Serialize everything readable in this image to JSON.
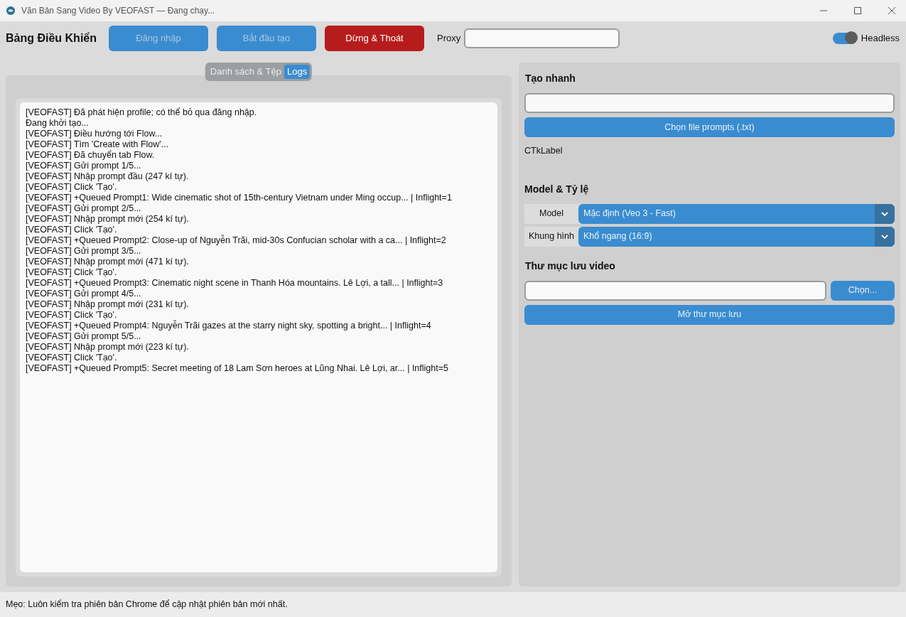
{
  "window": {
    "title": "Văn Bản Sang Video By VEOFAST — Đang chạy..."
  },
  "toolbar": {
    "title": "Bảng Điều Khiển",
    "buttons": [
      {
        "label": "Đăng nhập",
        "kind": "primary",
        "disabled": true
      },
      {
        "label": "Bắt đầu tạo",
        "kind": "primary",
        "disabled": true
      },
      {
        "label": "Dừng & Thoát",
        "kind": "danger",
        "disabled": false
      }
    ],
    "proxy": {
      "label": "Proxy"
    },
    "headless": {
      "label": "Headless",
      "on": true
    }
  },
  "tabs": [
    {
      "label": "Danh sách & Tệp",
      "selected": false
    },
    {
      "label": "Logs",
      "selected": true
    }
  ],
  "log_lines": [
    "[VEOFAST] Đã phát hiện profile; có thể bỏ qua đăng nhập.",
    "Đang khởi tạo...",
    "[VEOFAST] Điều hướng tới Flow...",
    "[VEOFAST] Tìm 'Create with Flow'...",
    "[VEOFAST] Đã chuyển tab Flow.",
    "[VEOFAST] Gửi prompt 1/5...",
    "[VEOFAST] Nhập prompt đầu (247 kí tự).",
    "[VEOFAST] Click 'Tạo'.",
    "[VEOFAST] +Queued Prompt1: Wide cinematic shot of 15th-century Vietnam under Ming occup... | Inflight=1",
    "[VEOFAST] Gửi prompt 2/5...",
    "[VEOFAST] Nhập prompt mới (254 kí tự).",
    "[VEOFAST] Click 'Tạo'.",
    "[VEOFAST] +Queued Prompt2: Close-up of Nguyễn Trãi, mid-30s Confucian scholar with a ca... | Inflight=2",
    "[VEOFAST] Gửi prompt 3/5...",
    "[VEOFAST] Nhập prompt mới (471 kí tự).",
    "[VEOFAST] Click 'Tạo'.",
    "[VEOFAST] +Queued Prompt3: Cinematic night scene in Thanh Hóa mountains. Lê Lợi, a tall... | Inflight=3",
    "[VEOFAST] Gửi prompt 4/5...",
    "[VEOFAST] Nhập prompt mới (231 kí tự).",
    "[VEOFAST] Click 'Tạo'.",
    "[VEOFAST] +Queued Prompt4: Nguyễn Trãi gazes at the starry night sky, spotting a bright... | Inflight=4",
    "[VEOFAST] Gửi prompt 5/5...",
    "[VEOFAST] Nhập prompt mới (223 kí tự).",
    "[VEOFAST] Click 'Tạo'.",
    "[VEOFAST] +Queued Prompt5: Secret meeting of 18 Lam Sơn heroes at Lũng Nhai. Lê Lợi, ar... | Inflight=5"
  ],
  "quick_create": {
    "title": "Tạo nhanh",
    "file_button": "Chọn file prompts (.txt)",
    "status_label": "CTkLabel"
  },
  "model_ratio": {
    "title": "Model & Tỷ lệ",
    "rows": [
      {
        "label": "Model",
        "value": "Mặc định (Veo 3 - Fast)"
      },
      {
        "label": "Khung hình",
        "value": "Khổ ngang (16:9)"
      }
    ]
  },
  "save_folder": {
    "title": "Thư mục lưu video",
    "choose_button": "Chọn...",
    "open_button": "Mở thư mục lưu"
  },
  "status_bar": "Mẹo: Luôn kiểm tra phiên bản Chrome để cập nhật phiên bản mới nhất."
}
